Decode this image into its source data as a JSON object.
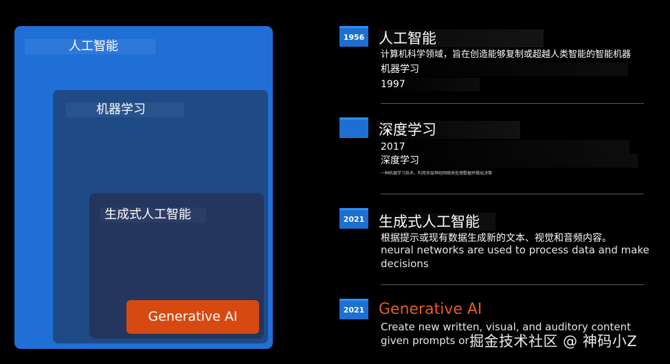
{
  "diagram": {
    "outer_box": {
      "label": "人工智能"
    },
    "middle_box": {
      "label": "机器学习"
    },
    "inner_box": {
      "label": "生成式人工智能"
    },
    "core_pill": {
      "label": "Generative AI"
    }
  },
  "timeline": [
    {
      "year": "1956",
      "title": "人工智能",
      "lines": [
        "计算机科学领域，旨在创造能够复制或超越人类智能的智能机器",
        "机器学习",
        "1997"
      ]
    },
    {
      "year": "",
      "title": "深度学习",
      "lines": [
        "2017",
        "深度学习",
        "一种机器学习技术，利用多层神经网络来处理数据并做出决策"
      ]
    },
    {
      "year": "2021",
      "title": "生成式人工智能",
      "lines": [
        "根据提示或现有数据生成新的文本、视觉和音频内容。",
        "neural networks are used to process data and make",
        "decisions"
      ]
    },
    {
      "year": "2021",
      "title": "Generative AI",
      "lines": [
        "Create new written, visual, and auditory content",
        "given prompts or"
      ]
    }
  ],
  "watermark": "掘金技术社区 @ 神码小Z",
  "colors": {
    "background": "#000000",
    "outer_box": "#1f6fd6",
    "middle_box": "#1e4a86",
    "inner_box": "#24365e",
    "pill": "#d64a11",
    "badge": "#1d6fd0",
    "highlight_title": "#e65c1e"
  }
}
